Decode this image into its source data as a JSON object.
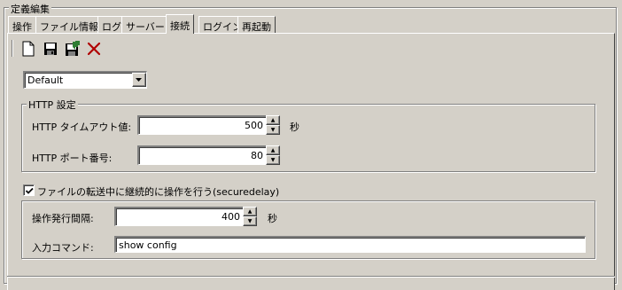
{
  "window": {
    "title": "定義編集"
  },
  "tabs": [
    {
      "label": "操作"
    },
    {
      "label": "ファイル情報"
    },
    {
      "label": "ログ"
    },
    {
      "label": "サーバー"
    },
    {
      "label": "接続",
      "active": true
    },
    {
      "label": "ログイン"
    },
    {
      "label": "再起動"
    }
  ],
  "toolbar": {
    "icons": [
      "new-document-icon",
      "save-icon",
      "save-as-icon",
      "delete-icon"
    ]
  },
  "profile_select": {
    "value": "Default"
  },
  "http_group": {
    "title": "HTTP 設定",
    "timeout_label": "HTTP タイムアウト値:",
    "timeout_value": "500",
    "timeout_unit": "秒",
    "port_label": "HTTP ポート番号:",
    "port_value": "80"
  },
  "secure_delay": {
    "checked": true,
    "label": "ファイルの転送中に継続的に操作を行う(securedelay)",
    "interval_label": "操作発行間隔:",
    "interval_value": "400",
    "interval_unit": "秒",
    "command_label": "入力コマンド:",
    "command_value": "show config"
  },
  "colors": {
    "face": "#d4d0c8",
    "delete_red": "#b00000",
    "save_green": "#2e7d32"
  }
}
